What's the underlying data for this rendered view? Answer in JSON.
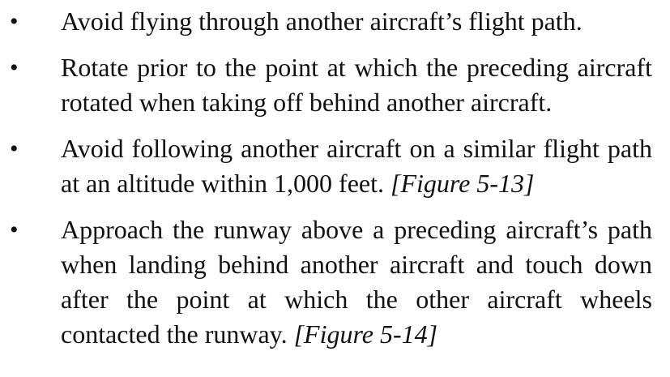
{
  "bullet_symbol": "•",
  "items": [
    {
      "text": "Avoid flying through another aircraft’s flight path.",
      "figure_ref": ""
    },
    {
      "text": "Rotate prior to the point at which the preceding aircraft rotated when taking off behind another aircraft.",
      "figure_ref": ""
    },
    {
      "text": "Avoid following another aircraft on a similar flight path at an altitude within 1,000 feet.",
      "figure_ref": "[Figure 5-13]"
    },
    {
      "text": "Approach the runway above a preceding aircraft’s path when landing behind another aircraft and touch down after the point at which the other aircraft wheels contacted the runway.",
      "figure_ref": "[Figure 5-14]"
    }
  ]
}
